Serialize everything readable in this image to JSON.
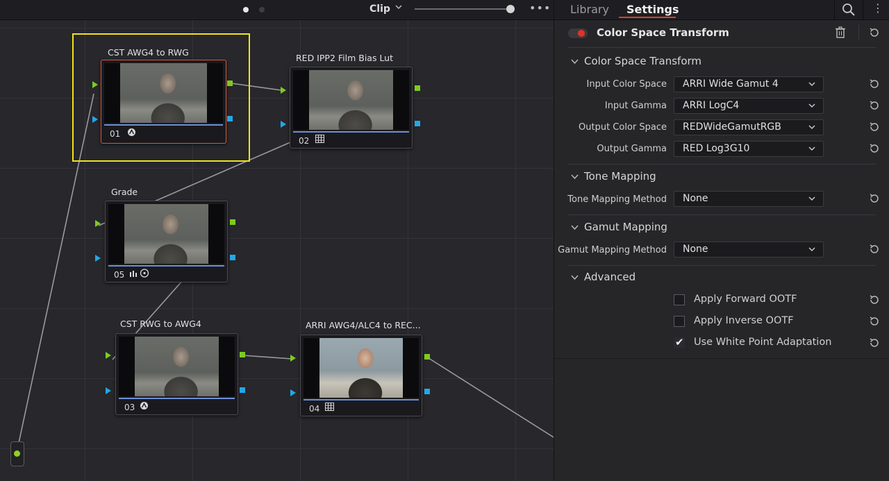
{
  "node_editor": {
    "toolbar": {
      "clip_label": "Clip",
      "more": "•••"
    },
    "nodes": [
      {
        "id": "01",
        "title": "CST AWG4 to RWG",
        "icon": "colorspace-icon",
        "selected": true
      },
      {
        "id": "02",
        "title": "RED IPP2 Film Bias Lut",
        "icon": "lut-grid-icon",
        "selected": false
      },
      {
        "id": "05",
        "title": "Grade",
        "icon": "curves-window-icon",
        "selected": false
      },
      {
        "id": "03",
        "title": "CST RWG  to AWG4",
        "icon": "colorspace-icon",
        "selected": false
      },
      {
        "id": "04",
        "title": "ARRI AWG4/ALC4 to REC...",
        "icon": "lut-grid-icon",
        "selected": false
      }
    ]
  },
  "inspector": {
    "tabs": [
      {
        "label": "Library"
      },
      {
        "label": "Settings",
        "active": true
      }
    ],
    "effect_title": "Color Space Transform",
    "effect_enabled": true,
    "sections": {
      "cst": {
        "title": "Color Space Transform",
        "params": [
          {
            "label": "Input Color Space",
            "value": "ARRI Wide Gamut 4"
          },
          {
            "label": "Input Gamma",
            "value": "ARRI LogC4"
          },
          {
            "label": "Output Color Space",
            "value": "REDWideGamutRGB"
          },
          {
            "label": "Output Gamma",
            "value": "RED Log3G10"
          }
        ]
      },
      "tone": {
        "title": "Tone Mapping",
        "param": {
          "label": "Tone Mapping Method",
          "value": "None"
        }
      },
      "gamut": {
        "title": "Gamut Mapping",
        "param": {
          "label": "Gamut Mapping Method",
          "value": "None"
        }
      },
      "advanced": {
        "title": "Advanced",
        "options": [
          {
            "label": "Apply Forward OOTF",
            "checked": false
          },
          {
            "label": "Apply Inverse OOTF",
            "checked": false
          },
          {
            "label": "Use White Point Adaptation",
            "checked": true
          }
        ]
      }
    }
  },
  "colors": {
    "rgb_port": "#7ecb20",
    "key_port": "#22a8e6",
    "accent_red": "#d9412b",
    "selection": "#f2e31a"
  }
}
